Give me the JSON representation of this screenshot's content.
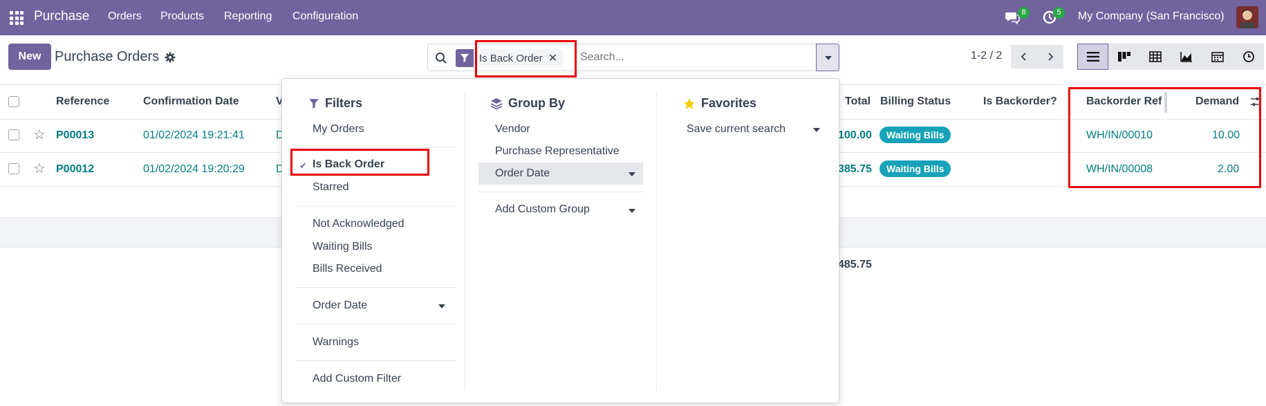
{
  "navbar": {
    "brand": "Purchase",
    "menu": [
      "Orders",
      "Products",
      "Reporting",
      "Configuration"
    ],
    "chat_count": "8",
    "activity_count": "5",
    "company": "My Company (San Francisco)"
  },
  "control": {
    "new_label": "New",
    "title": "Purchase Orders",
    "facet": "Is Back Order",
    "search_placeholder": "Search...",
    "pager": "1-2 / 2"
  },
  "table": {
    "headers": {
      "reference": "Reference",
      "confirmation_date": "Confirmation Date",
      "vendor_partial": "V",
      "total": "Total",
      "billing_status": "Billing Status",
      "is_backorder": "Is Backorder?",
      "backorder_ref": "Backorder Ref",
      "demand": "Demand"
    },
    "rows": [
      {
        "reference": "P00013",
        "confirmation_date": "01/02/2024 19:21:41",
        "vendor_partial": "D",
        "total": "100.00",
        "billing_status": "Waiting Bills",
        "backorder_ref": "WH/IN/00010",
        "demand": "10.00"
      },
      {
        "reference": "P00012",
        "confirmation_date": "01/02/2024 19:20:29",
        "vendor_partial": "D",
        "total": "385.75",
        "billing_status": "Waiting Bills",
        "backorder_ref": "WH/IN/00008",
        "demand": "2.00"
      }
    ],
    "grand_total": "485.75"
  },
  "dropdown": {
    "filters": {
      "title": "Filters",
      "items": [
        "My Orders",
        "Is Back Order",
        "Starred",
        "Not Acknowledged",
        "Waiting Bills",
        "Bills Received",
        "Order Date",
        "Warnings",
        "Add Custom Filter"
      ]
    },
    "group_by": {
      "title": "Group By",
      "items": [
        "Vendor",
        "Purchase Representative",
        "Order Date",
        "Add Custom Group"
      ]
    },
    "favorites": {
      "title": "Favorites",
      "items": [
        "Save current search"
      ]
    }
  },
  "colors": {
    "brand": "#71639e",
    "link": "#017e84",
    "badge": "#17a2b8",
    "highlight": "#e8000b"
  }
}
